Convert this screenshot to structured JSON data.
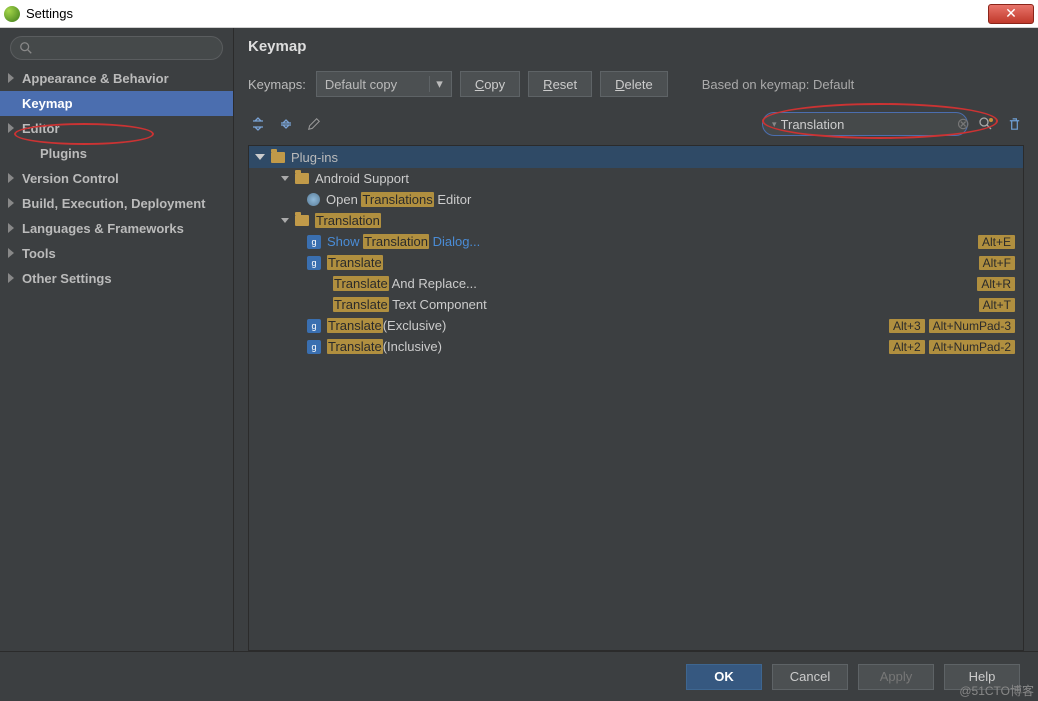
{
  "window": {
    "title": "Settings"
  },
  "sidebar": {
    "items": [
      {
        "label": "Appearance & Behavior",
        "arrow": true,
        "bold": true
      },
      {
        "label": "Keymap",
        "selected": true,
        "bold": true
      },
      {
        "label": "Editor",
        "arrow": true,
        "bold": true
      },
      {
        "label": "Plugins",
        "indent": true,
        "bold": true
      },
      {
        "label": "Version Control",
        "arrow": true,
        "bold": true
      },
      {
        "label": "Build, Execution, Deployment",
        "arrow": true,
        "bold": true
      },
      {
        "label": "Languages & Frameworks",
        "arrow": true,
        "bold": true
      },
      {
        "label": "Tools",
        "arrow": true,
        "bold": true
      },
      {
        "label": "Other Settings",
        "arrow": true,
        "bold": true
      }
    ]
  },
  "panel": {
    "title": "Keymap",
    "keymaps_label": "Keymaps:",
    "keymaps_value": "Default copy",
    "copy": "Copy",
    "reset": "Reset",
    "delete": "Delete",
    "based_on": "Based on keymap: Default",
    "search_value": "Translation"
  },
  "tree": {
    "root": "Plug-ins",
    "android_support": "Android Support",
    "open_pre": "Open ",
    "open_hl": "Translations",
    "open_post": " Editor",
    "translation_folder": "Translation",
    "show_pre": "Show ",
    "show_hl": "Translation",
    "show_post": " Dialog...",
    "translate": "Translate",
    "and_replace_pre": "Translate",
    "and_replace_post": " And Replace...",
    "text_comp_pre": "Translate",
    "text_comp_post": " Text Component",
    "exclusive_pre": "Translate",
    "exclusive_post": "(Exclusive)",
    "inclusive_pre": "Translate",
    "inclusive_post": "(Inclusive)"
  },
  "shortcuts": {
    "alt_e": "Alt+E",
    "alt_f": "Alt+F",
    "alt_r": "Alt+R",
    "alt_t": "Alt+T",
    "alt_3": "Alt+3",
    "alt_np3": "Alt+NumPad-3",
    "alt_2": "Alt+2",
    "alt_np2": "Alt+NumPad-2"
  },
  "buttons": {
    "ok": "OK",
    "cancel": "Cancel",
    "apply": "Apply",
    "help": "Help"
  },
  "watermark": "@51CTO博客"
}
